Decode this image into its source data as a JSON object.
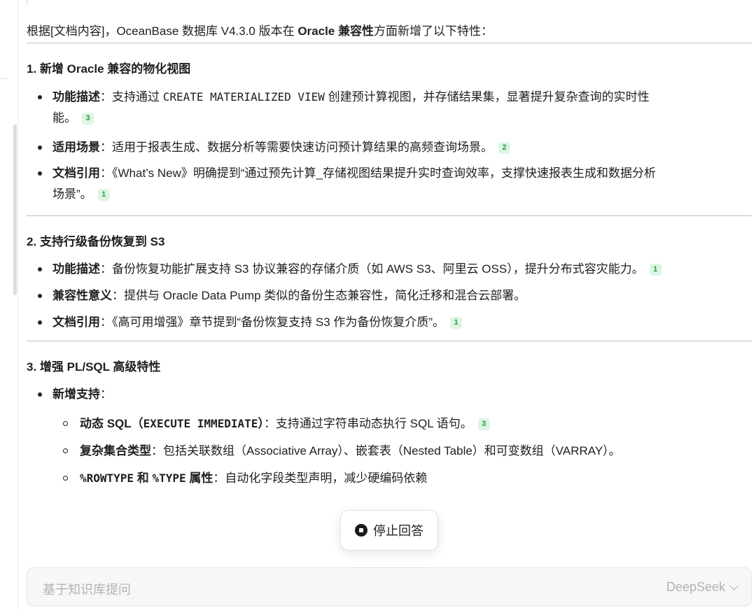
{
  "intro": {
    "prefix": "根据[文档内容]，OceanBase 数据库 V4.3.0 版本在 ",
    "bold": "Oracle 兼容性",
    "suffix": "方面新增了以下特性："
  },
  "sections": [
    {
      "title": "1. 新增 Oracle 兼容的物化视图",
      "items": [
        {
          "label": "功能描述",
          "sep": "：",
          "text1": "支持通过 ",
          "code": "CREATE MATERIALIZED VIEW",
          "text2": " 创建预计算视图，并存储结果集，显著提升复杂查询的实时性",
          "text3": "能。",
          "cite": "3"
        },
        {
          "label": "适用场景",
          "sep": "：",
          "text": "适用于报表生成、数据分析等需要快速访问预计算结果的高频查询场景。",
          "cite": "2"
        },
        {
          "label": "文档引用",
          "sep": "：",
          "text1": "《What’s New》明确提到“通过预先计算_存储视图结果提升实时查询效率，支撑快速报表生成和数据分析",
          "text2": "场景”。",
          "cite": "1"
        }
      ]
    },
    {
      "title": "2. 支持行级备份恢复到 S3",
      "items": [
        {
          "label": "功能描述",
          "sep": "：",
          "text": "备份恢复功能扩展支持 S3 协议兼容的存储介质（如 AWS S3、阿里云 OSS），提升分布式容灾能力。",
          "cite": "1"
        },
        {
          "label": "兼容性意义",
          "sep": "：",
          "text": "提供与 Oracle Data Pump 类似的备份生态兼容性，简化迁移和混合云部署。"
        },
        {
          "label": "文档引用",
          "sep": "：",
          "text": "《高可用增强》章节提到“备份恢复支持 S3 作为备份恢复介质”。",
          "cite": "1"
        }
      ]
    },
    {
      "title": "3. 增强 PL/SQL 高级特性",
      "items": [
        {
          "label": "新增支持",
          "sep": "："
        }
      ],
      "subitems": [
        {
          "label_prefix": "动态 SQL（",
          "label_code": "EXECUTE IMMEDIATE",
          "label_suffix": "）",
          "sep": "：",
          "text": "支持通过字符串动态执行 SQL 语句。",
          "cite": "3"
        },
        {
          "label": "复杂集合类型",
          "sep": "：",
          "text": "包括关联数组（Associative Array）、嵌套表（Nested Table）和可变数组（VARRAY）。"
        },
        {
          "label_code1": "%ROWTYPE",
          "label_mid": " 和 ",
          "label_code2": "%TYPE",
          "label_suffix": " 属性",
          "sep": "：",
          "text": "自动化字段类型声明，减少硬编码依赖"
        }
      ]
    }
  ],
  "stop_button": {
    "label": "停止回答",
    "icon": "stop-icon"
  },
  "input": {
    "placeholder": "基于知识库提问",
    "model": "DeepSeek",
    "model_icon": "chevron-down-icon"
  }
}
